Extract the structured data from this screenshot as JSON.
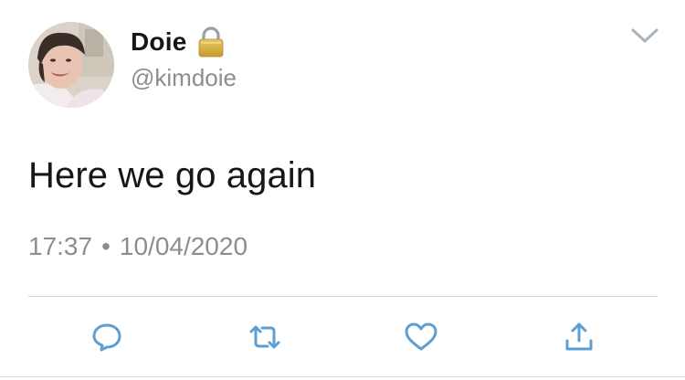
{
  "user": {
    "display_name": "Doie",
    "handle": "@kimdoie",
    "protected_icon": "lock-icon"
  },
  "tweet": {
    "text": "Here we go again",
    "time": "17:37",
    "separator": "•",
    "date": "10/04/2020"
  },
  "actions": [
    {
      "name": "reply",
      "icon": "reply-icon"
    },
    {
      "name": "retweet",
      "icon": "retweet-icon"
    },
    {
      "name": "like",
      "icon": "heart-icon"
    },
    {
      "name": "share",
      "icon": "share-icon"
    }
  ],
  "colors": {
    "text_primary": "#14171a",
    "text_secondary": "#8a8d91",
    "icon_accent": "#5e9fd3"
  }
}
